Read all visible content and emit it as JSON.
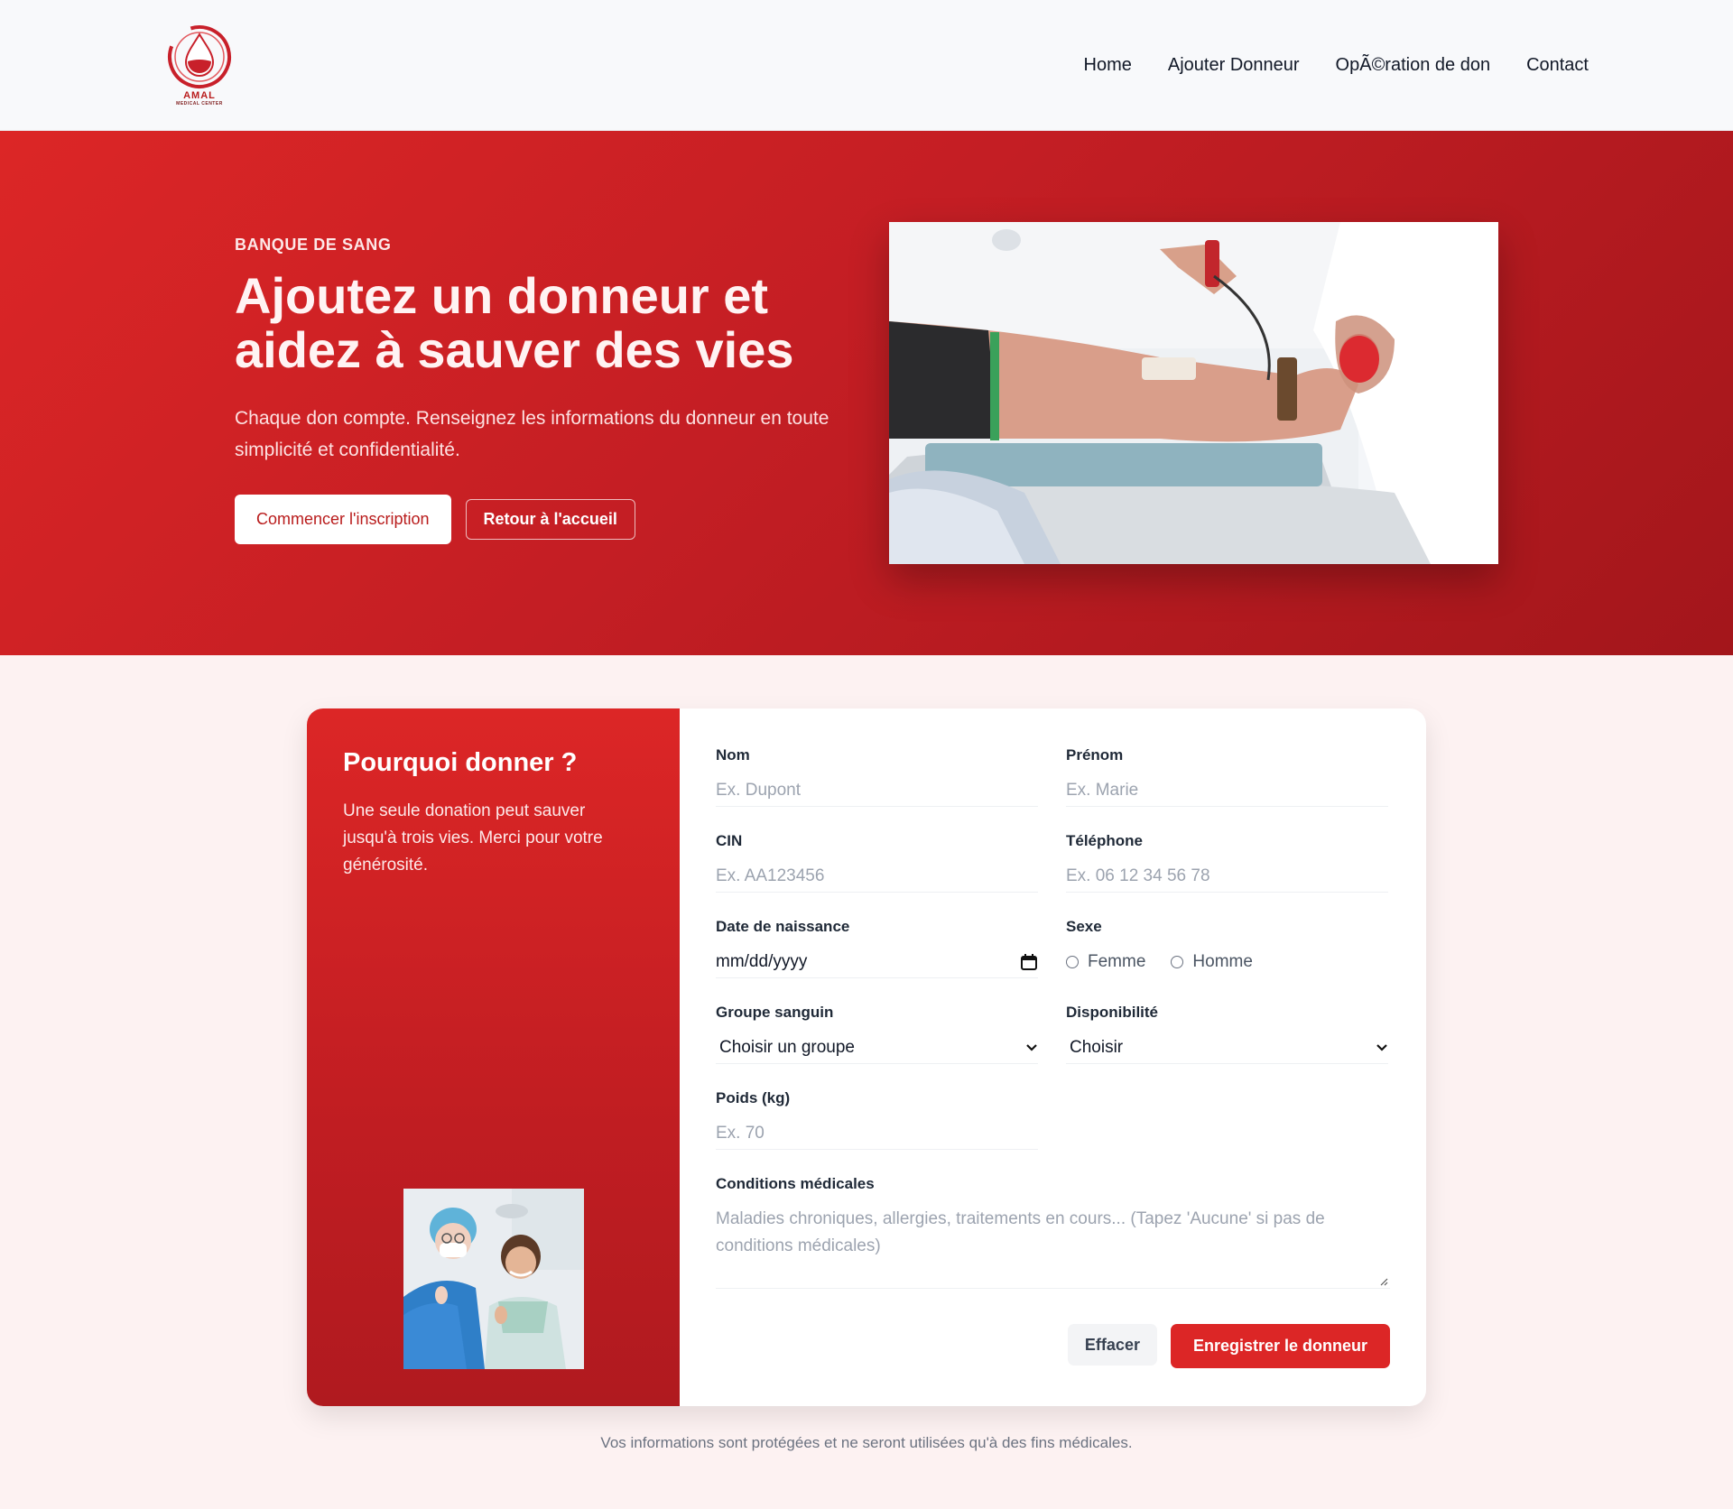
{
  "brand": {
    "name": "AMAL",
    "sub": "MEDICAL CENTER"
  },
  "nav": {
    "items": [
      "Home",
      "Ajouter Donneur",
      "OpÃ©ration de don",
      "Contact"
    ]
  },
  "hero": {
    "eyebrow": "BANQUE DE SANG",
    "title_line1": "Ajoutez un donneur et",
    "title_line2": "aidez à sauver des vies",
    "lead": "Chaque don compte. Renseignez les informations du donneur en toute simplicité et confidentialité.",
    "primary_cta": "Commencer l'inscription",
    "secondary_cta": "Retour à l'accueil"
  },
  "aside": {
    "title": "Pourquoi donner ?",
    "text": "Une seule donation peut sauver jusqu'à trois vies. Merci pour votre générosité."
  },
  "form": {
    "nom": {
      "label": "Nom",
      "placeholder": "Ex. Dupont"
    },
    "prenom": {
      "label": "Prénom",
      "placeholder": "Ex. Marie"
    },
    "cin": {
      "label": "CIN",
      "placeholder": "Ex. AA123456"
    },
    "telephone": {
      "label": "Téléphone",
      "placeholder": "Ex. 06 12 34 56 78"
    },
    "naissance": {
      "label": "Date de naissance",
      "value": "mm/dd/yyyy"
    },
    "sexe": {
      "label": "Sexe",
      "options": [
        "Femme",
        "Homme"
      ]
    },
    "groupe": {
      "label": "Groupe sanguin",
      "value": "Choisir un groupe"
    },
    "disponibilite": {
      "label": "Disponibilité",
      "value": "Choisir"
    },
    "poids": {
      "label": "Poids (kg)",
      "placeholder": "Ex. 70"
    },
    "conditions": {
      "label": "Conditions médicales",
      "placeholder": "Maladies chroniques, allergies, traitements en cours... (Tapez 'Aucune' si pas de conditions médicales)"
    },
    "clear_label": "Effacer",
    "submit_label": "Enregistrer le donneur"
  },
  "footnote": "Vos informations sont protégées et ne seront utilisées qu'à des fins médicales.",
  "colors": {
    "accent": "#dc2626",
    "accent_dark": "#b91c1c",
    "page_bg": "#fdf2f2"
  }
}
